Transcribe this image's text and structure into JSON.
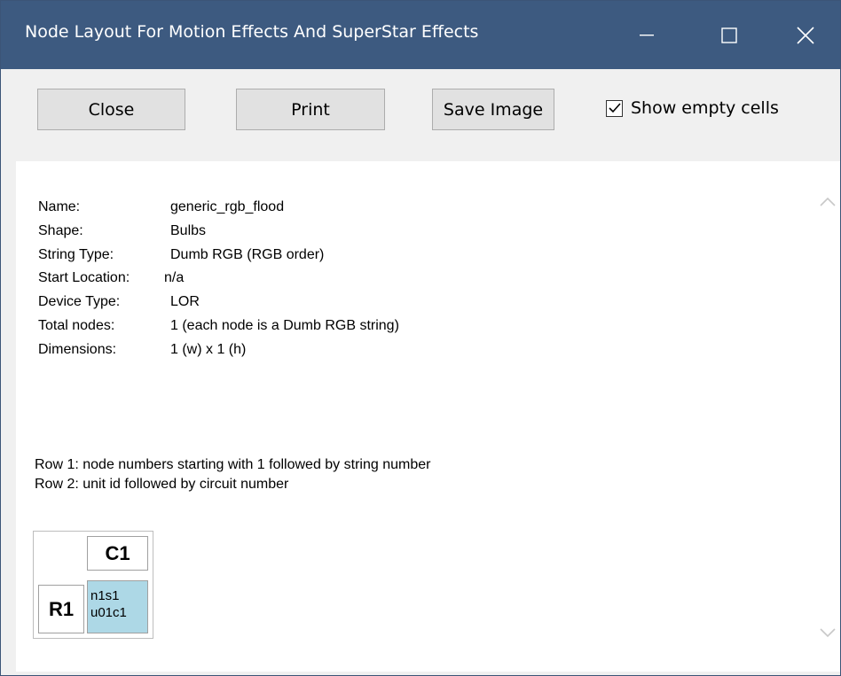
{
  "window": {
    "title": "Node Layout For Motion Effects And SuperStar Effects",
    "controls": {
      "minimize": "minimize-icon",
      "maximize": "maximize-icon",
      "close": "close-icon"
    }
  },
  "toolbar": {
    "close_label": "Close",
    "print_label": "Print",
    "save_label": "Save Image",
    "show_empty_label": "Show empty cells",
    "show_empty_checked": true
  },
  "info": {
    "rows": [
      {
        "label": "Name:",
        "value": "generic_rgb_flood"
      },
      {
        "label": "Shape:",
        "value": "Bulbs"
      },
      {
        "label": "String Type:",
        "value": "Dumb RGB (RGB order)"
      },
      {
        "label": "Start Location:",
        "value": "n/a"
      },
      {
        "label": "Device Type:",
        "value": "LOR"
      },
      {
        "label": "Total nodes:",
        "value": "1 (each node is a Dumb RGB string)"
      },
      {
        "label": "Dimensions:",
        "value": "1 (w) x 1 (h)"
      }
    ]
  },
  "legend": {
    "line1": "Row 1: node numbers starting with 1 followed by string number",
    "line2": "Row 2: unit id followed by circuit number"
  },
  "grid": {
    "column_header": "C1",
    "row_header": "R1",
    "cell_line1": "n1s1",
    "cell_line2": "u01c1",
    "cell_color": "#add8e6"
  },
  "colors": {
    "titlebar": "#3d5a80",
    "toolbar_bg": "#f0f0f0",
    "button_bg": "#e1e1e1"
  }
}
